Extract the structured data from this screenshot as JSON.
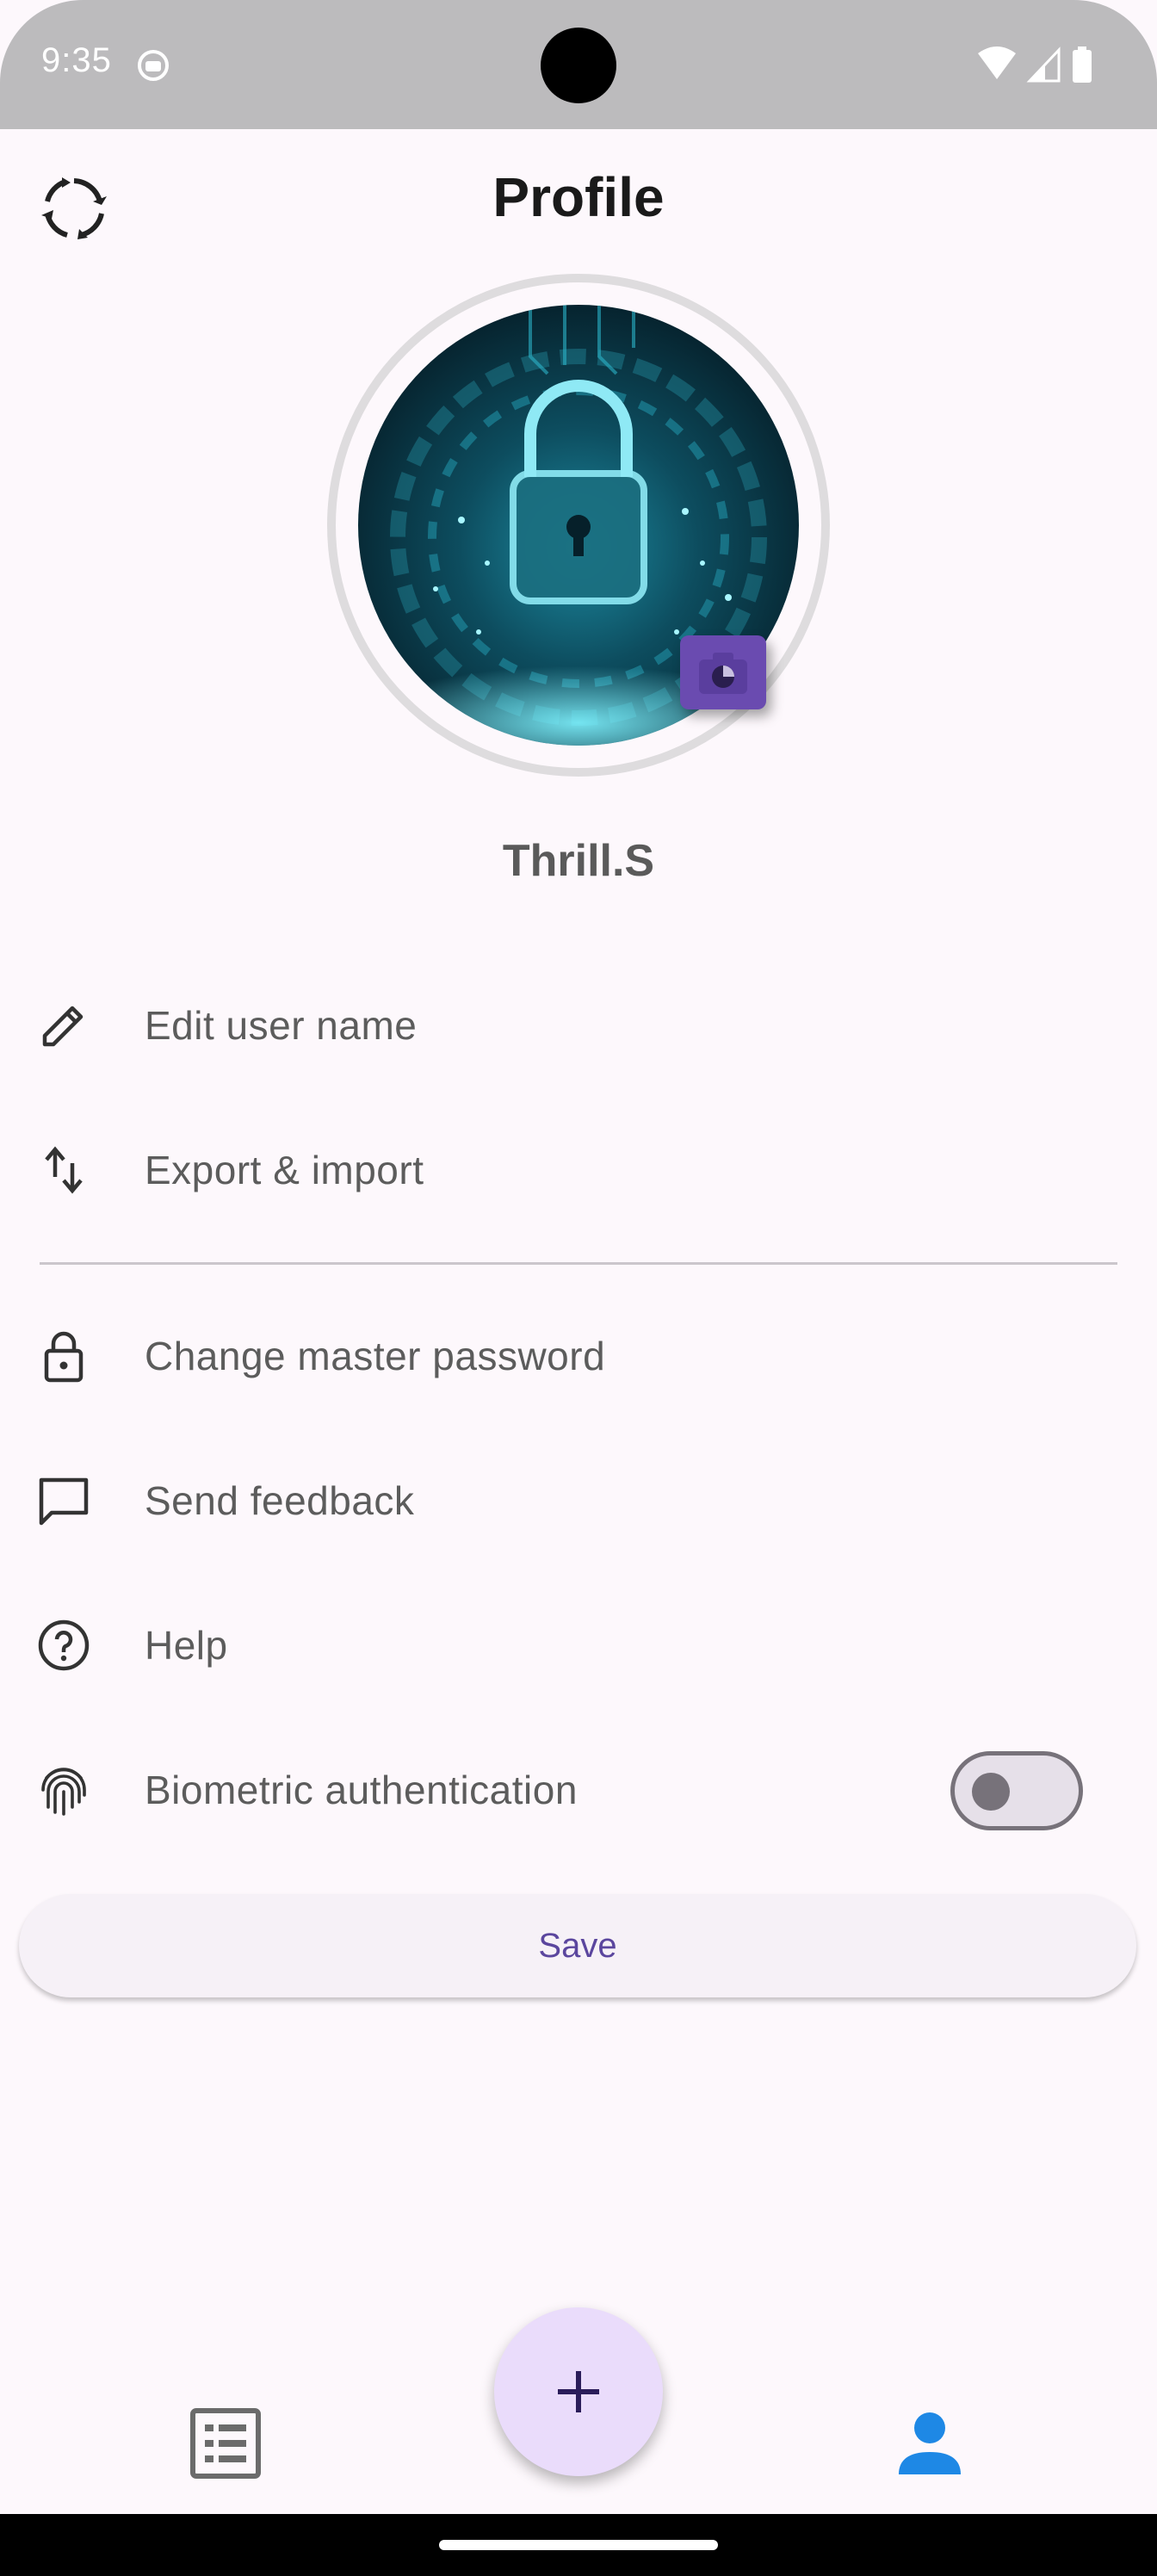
{
  "status_bar": {
    "time": "9:35"
  },
  "header": {
    "title": "Profile"
  },
  "profile": {
    "user_name": "Thrill.S"
  },
  "menu": {
    "items": [
      {
        "label": "Edit user name",
        "icon": "pencil-icon"
      },
      {
        "label": "Export & import",
        "icon": "swap-vertical-icon"
      },
      {
        "label": "Change master password",
        "icon": "lock-icon"
      },
      {
        "label": "Send feedback",
        "icon": "chat-bubble-icon"
      },
      {
        "label": "Help",
        "icon": "help-circle-icon"
      },
      {
        "label": "Biometric authentication",
        "icon": "fingerprint-icon"
      }
    ]
  },
  "biometric_toggle": {
    "enabled": false
  },
  "actions": {
    "save_label": "Save"
  },
  "colors": {
    "accent": "#5b469e",
    "fab_background": "#eadcfb",
    "nav_active": "#1e88e5",
    "camera_badge": "#6a4bb0"
  }
}
